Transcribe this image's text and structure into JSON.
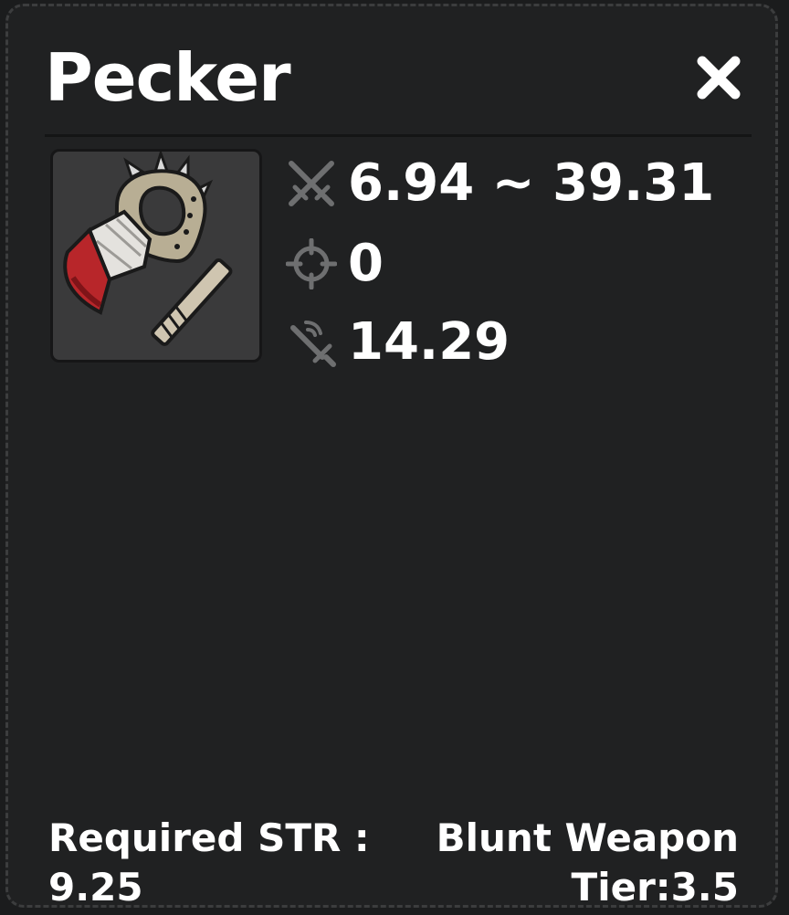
{
  "item": {
    "name": "Pecker",
    "image": "bandaged-blunt-weapon-icon"
  },
  "stats": [
    {
      "icon": "crossed-swords-icon",
      "value": "6.94 ~ 39.31"
    },
    {
      "icon": "crosshair-icon",
      "value": "0"
    },
    {
      "icon": "sword-speed-icon",
      "value": "14.29"
    }
  ],
  "footer": {
    "requirement_label": "Required STR :",
    "requirement_value": "9.25",
    "weapon_type": "Blunt Weapon",
    "tier": "Tier:3.5"
  },
  "colors": {
    "background": "#202122",
    "text": "#ffffff",
    "icon": "#6e6f70",
    "accent_red": "#b8262a"
  }
}
